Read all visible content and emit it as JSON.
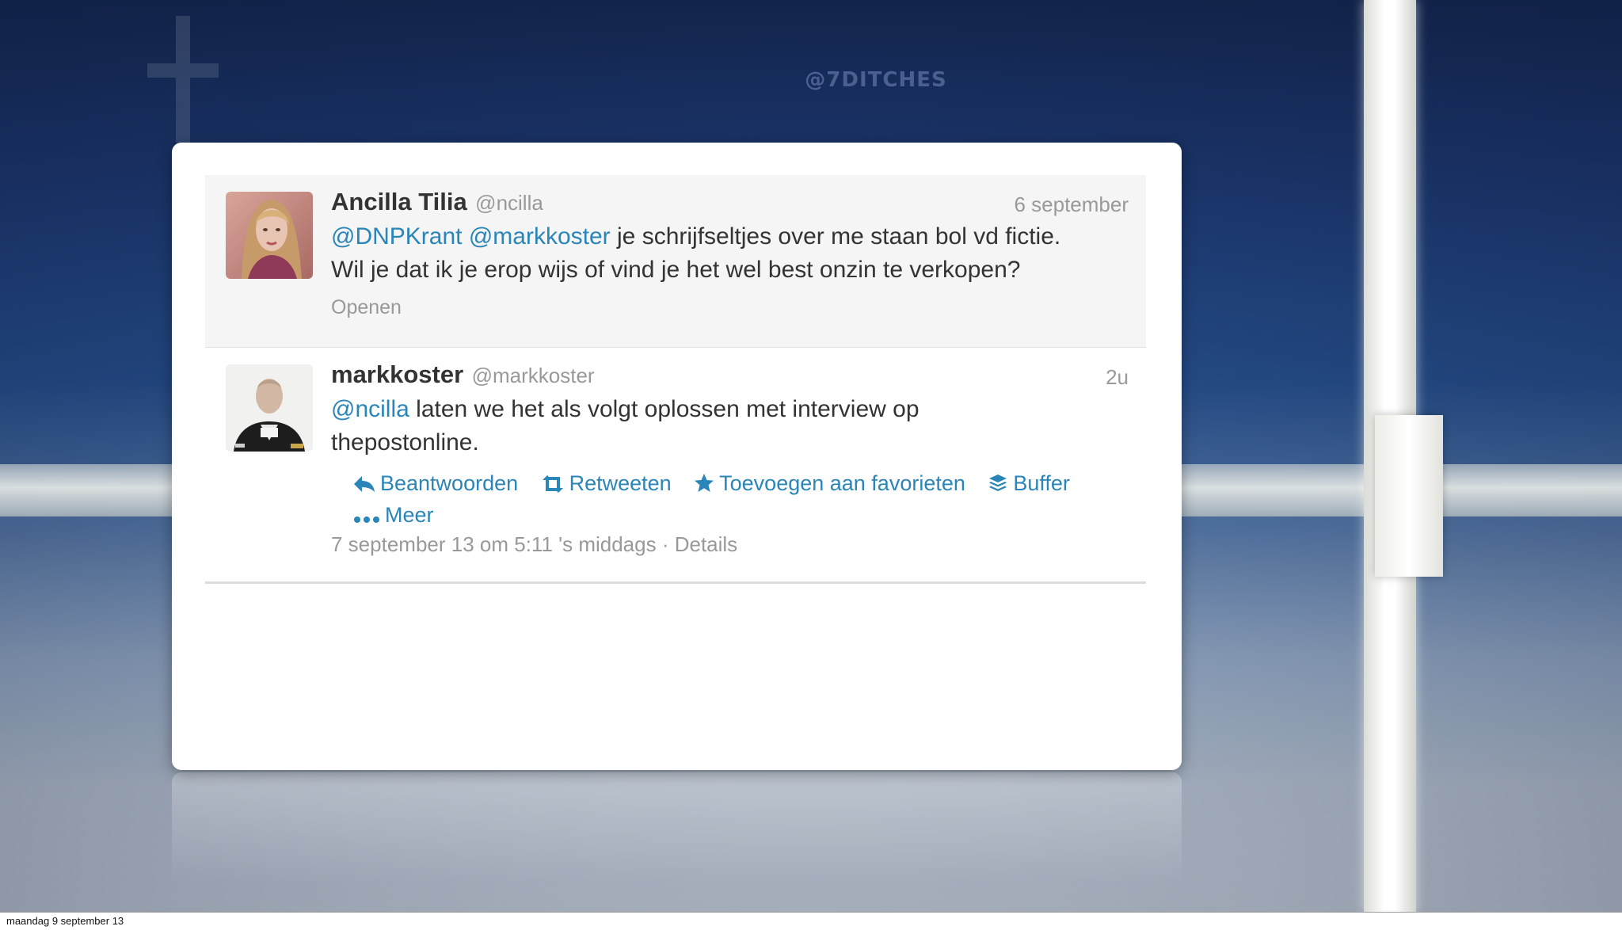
{
  "watermark": "@7DITCHES",
  "tweets": [
    {
      "name": "Ancilla Tilia",
      "handle": "@ncilla",
      "time": "6 september",
      "mentions": [
        "@DNPKrant",
        "@markkoster"
      ],
      "text_line1_rest": " je schrijfseltjes over me staan bol vd fictie.",
      "text_line2": "Wil je dat ik je erop wijs of vind je het wel best onzin te verkopen?",
      "open_label": "Openen"
    },
    {
      "name": "markkoster",
      "handle": "@markkoster",
      "time": "2u",
      "mention": "@ncilla",
      "text_line1_rest": " laten we het als volgt oplossen met interview op",
      "text_line2": "thepostonline.",
      "actions": {
        "reply": "Beantwoorden",
        "retweet": "Retweeten",
        "favorite": "Toevoegen aan favorieten",
        "buffer": "Buffer",
        "more": "Meer"
      },
      "timestamp": "7 september 13 om 5:11 's middags",
      "separator": " · ",
      "details": "Details"
    }
  ],
  "status_bar": {
    "date": "maandag 9 september 13"
  },
  "colors": {
    "link": "#2a85b8",
    "muted": "#999999",
    "text": "#333333"
  },
  "icons": [
    "reply-icon",
    "retweet-icon",
    "star-icon",
    "buffer-icon",
    "more-icon"
  ]
}
